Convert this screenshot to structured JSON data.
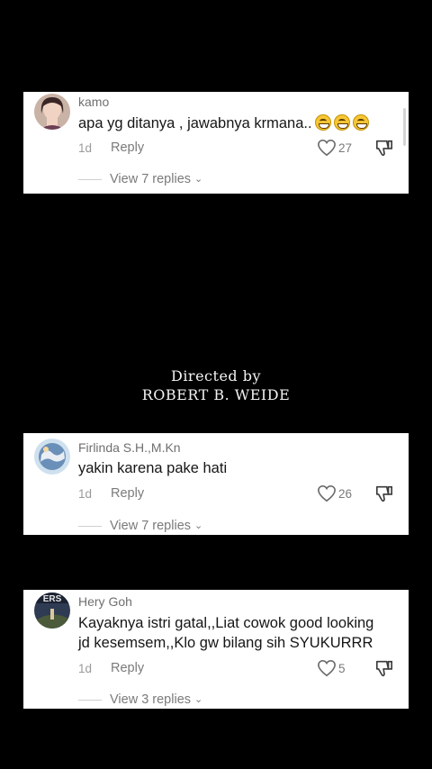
{
  "comments": [
    {
      "username": "kamo",
      "text": "apa yg ditanya , jawabnya krmana..",
      "emoji": "grinning-face-emoji x3",
      "time": "1d",
      "reply_label": "Reply",
      "likes": "27",
      "view_replies": "View 7 replies"
    },
    {
      "username": "Firlinda S.H.,M.Kn",
      "text": "yakin karena pake hati",
      "time": "1d",
      "reply_label": "Reply",
      "likes": "26",
      "view_replies": "View 7 replies"
    },
    {
      "username": "Hery Goh",
      "text_line1": "Kayaknya istri gatal,,Liat cowok good looking",
      "text_line2": "jd kesemsem,,Klo gw bilang sih SYUKURRR",
      "avatar_text": "ERS",
      "time": "1d",
      "reply_label": "Reply",
      "likes": "5",
      "view_replies": "View 3 replies"
    }
  ],
  "credits": {
    "line1": "Directed by",
    "line2": "ROBERT B. WEIDE"
  },
  "icons": {
    "like": "heart-outline-icon",
    "dislike": "thumbs-down-icon",
    "expand": "chevron-down-icon"
  }
}
